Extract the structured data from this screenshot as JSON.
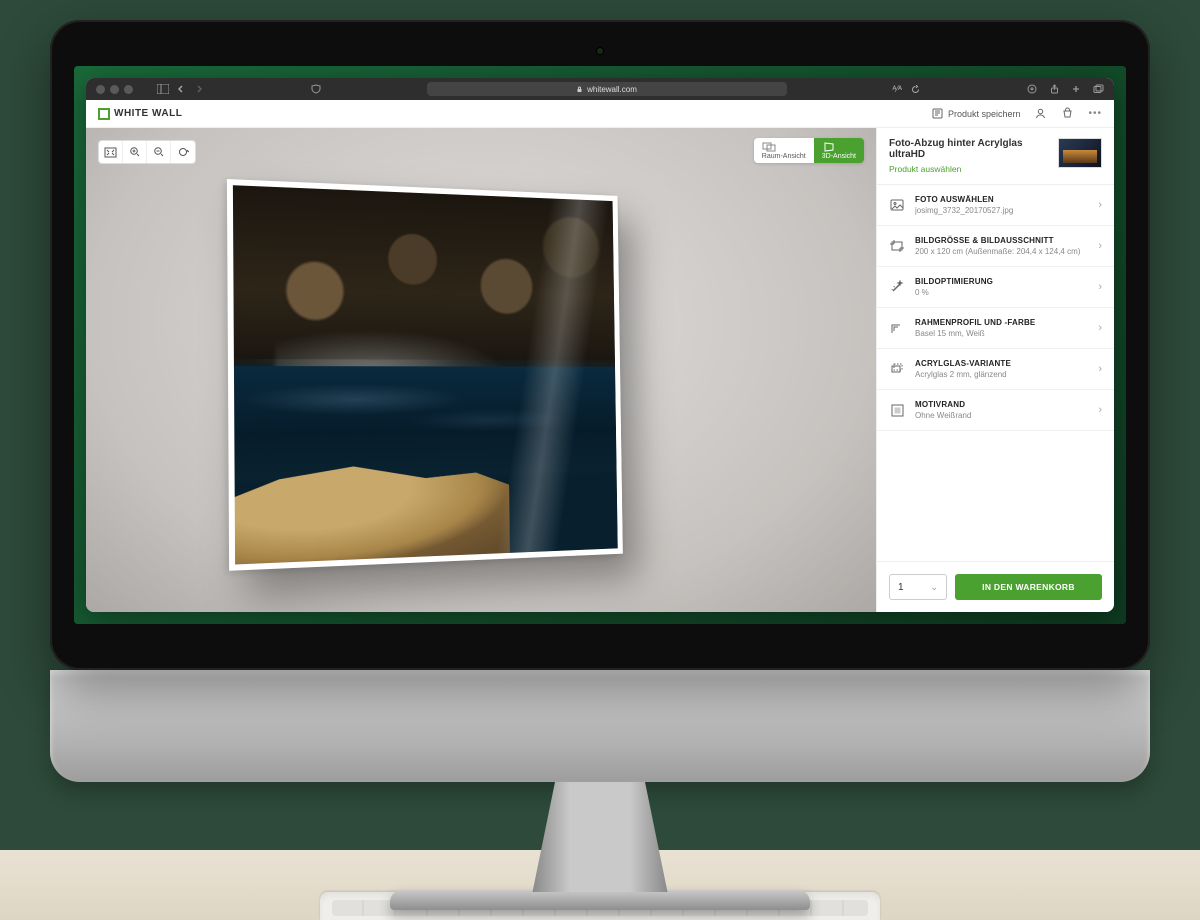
{
  "browser": {
    "url_host": "whitewall.com",
    "lock_icon": "lock-icon"
  },
  "header": {
    "brand": "WHITE WALL",
    "save_product_label": "Produkt speichern"
  },
  "view_tabs": {
    "room": "Raum-Ansicht",
    "three_d": "3D-Ansicht"
  },
  "product": {
    "title": "Foto-Abzug hinter Acrylglas ultraHD",
    "select_link": "Produkt auswählen"
  },
  "options": [
    {
      "title": "FOTO AUSWÄHLEN",
      "value": "josimg_3732_20170527.jpg"
    },
    {
      "title": "BILDGRÖSSE & BILDAUSSCHNITT",
      "value": "200 x 120 cm (Außenmaße: 204,4 x 124,4 cm)"
    },
    {
      "title": "BILDOPTIMIERUNG",
      "value": "0 %"
    },
    {
      "title": "RAHMENPROFIL UND -FARBE",
      "value": "Basel 15 mm, Weiß"
    },
    {
      "title": "ACRYLGLAS-VARIANTE",
      "value": "Acrylglas 2 mm, glänzend"
    },
    {
      "title": "MOTIVRAND",
      "value": "Ohne Weißrand"
    }
  ],
  "footer": {
    "qty": "1",
    "add_to_cart": "IN DEN WARENKORB"
  }
}
